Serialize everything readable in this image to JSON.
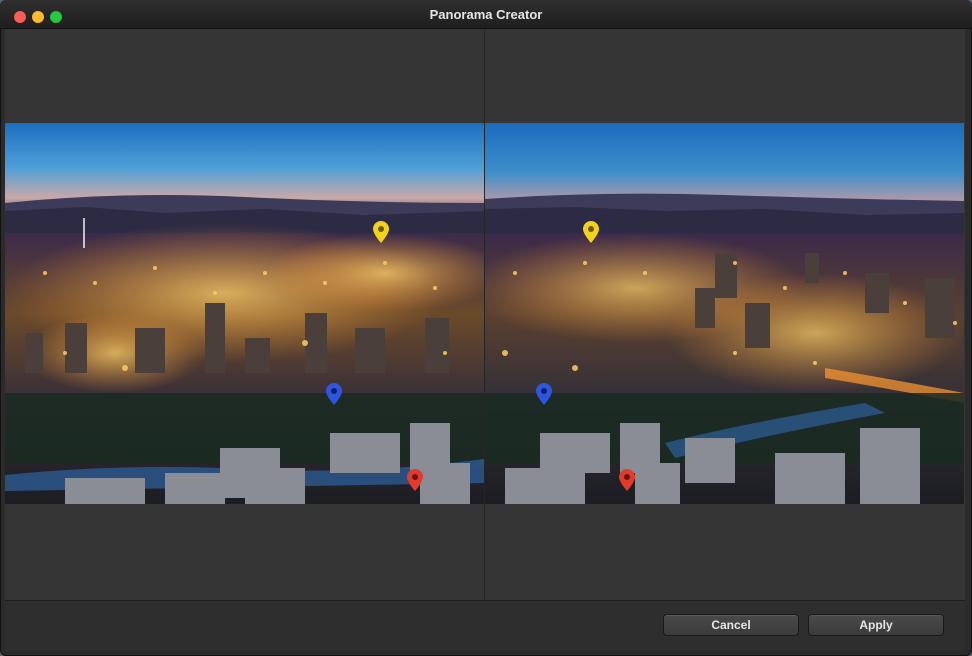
{
  "window": {
    "title": "Panorama Creator"
  },
  "panes": [
    {
      "id": "left",
      "image": "night city skyline left frame"
    },
    {
      "id": "right",
      "image": "night city skyline right frame"
    }
  ],
  "markers": {
    "colors": {
      "yellow": "#f2d21b",
      "blue": "#2f56e0",
      "red": "#e23b2e"
    }
  },
  "footer": {
    "cancel_label": "Cancel",
    "apply_label": "Apply"
  },
  "colors": {
    "window_bg": "#353535",
    "footer_bg": "#2e2e2e",
    "close": "#fc5f57",
    "minimize": "#fdbc2e",
    "maximize": "#28c840"
  }
}
